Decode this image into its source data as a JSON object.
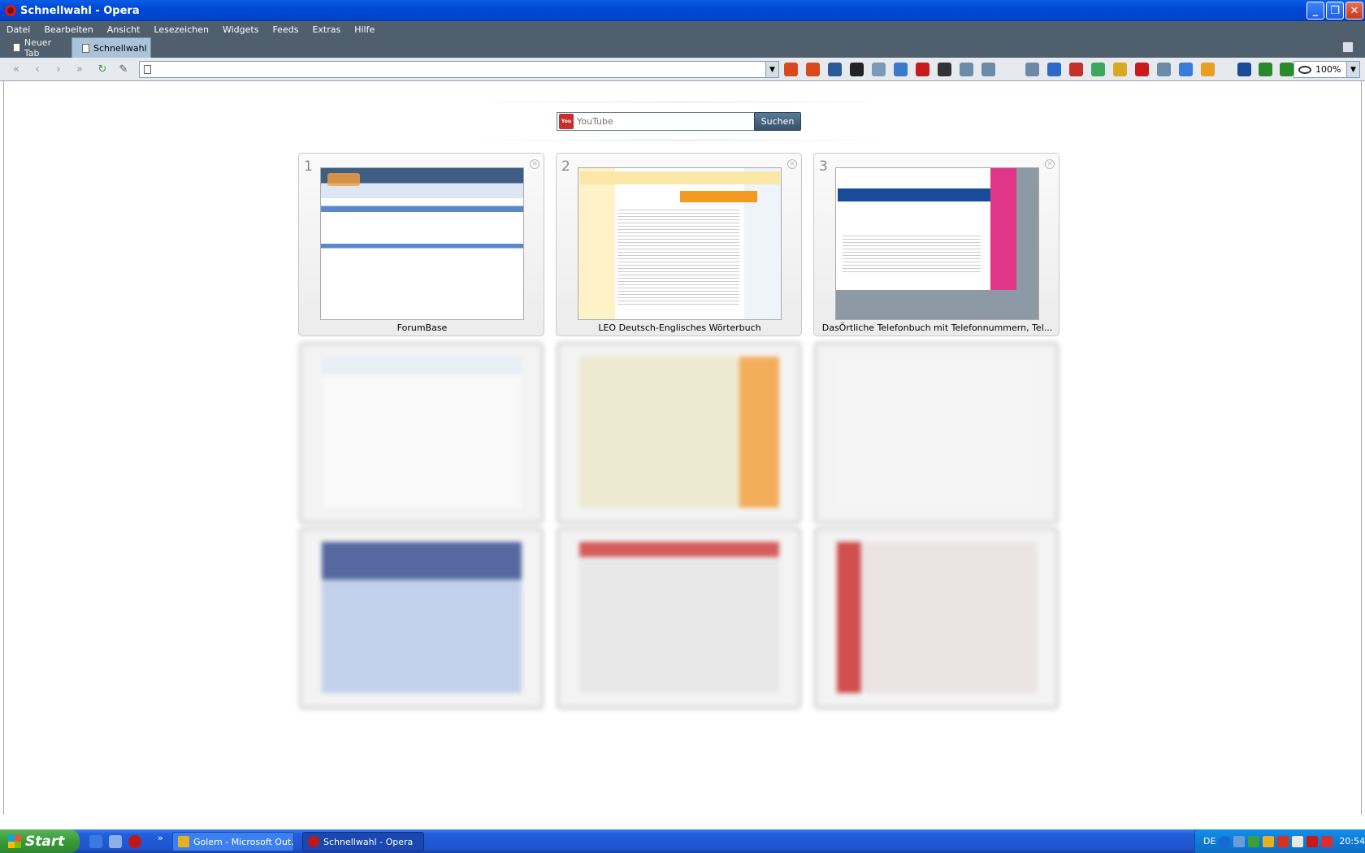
{
  "window": {
    "title": "Schnellwahl - Opera"
  },
  "menu": [
    "Datei",
    "Bearbeiten",
    "Ansicht",
    "Lesezeichen",
    "Widgets",
    "Feeds",
    "Extras",
    "Hilfe"
  ],
  "tabs": [
    {
      "label": "Neuer Tab",
      "active": false
    },
    {
      "label": "Schnellwahl",
      "active": true
    }
  ],
  "address": {
    "value": ""
  },
  "zoom": "100%",
  "search": {
    "placeholder": "YouTube",
    "button": "Suchen",
    "engine_icon": "youtube-icon"
  },
  "speed_dial": [
    {
      "number": "1",
      "title": "ForumBase"
    },
    {
      "number": "2",
      "title": "LEO Deutsch-Englisches Wörterbuch"
    },
    {
      "number": "3",
      "title": "DasÖrtliche Telefonbuch mit Telefonnummern, Tel..."
    }
  ],
  "taskbar": {
    "start": "Start",
    "windows": [
      {
        "label": "Golem - Microsoft Out...",
        "icon": "outlook-icon"
      },
      {
        "label": "Schnellwahl - Opera",
        "icon": "opera-icon"
      }
    ],
    "tray": {
      "lang": "DE",
      "time": "20:54"
    }
  },
  "colors": {
    "titlebar": "#0a5de6",
    "chrome": "#4f5f6e",
    "active_tab": "#a9c3d9",
    "taskbar": "#245edb",
    "start": "#399b39"
  }
}
